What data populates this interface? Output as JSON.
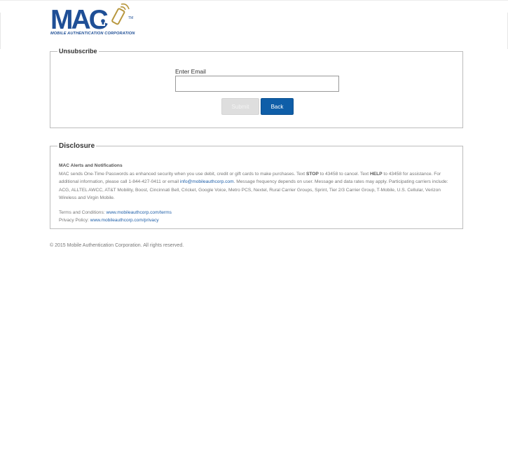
{
  "logo": {
    "title": "MAC",
    "tagline": "MOBILE AUTHENTICATION CORPORATION",
    "tm": "TM"
  },
  "unsubscribe": {
    "legend": "Unsubscribe",
    "email_label": "Enter Email",
    "email_value": "",
    "email_placeholder": "",
    "submit_label": "Submit",
    "back_label": "Back"
  },
  "disclosure": {
    "legend": "Disclosure",
    "title": "MAC Alerts and Notifications",
    "p1_a": "MAC sends One-Time Passwords as enhanced security when you use debit, credit or gift cards to make purchases. Text ",
    "stop": "STOP",
    "p1_b": " to 43458 to cancel. Text ",
    "help": "HELP",
    "p1_c": " to 43458 for assistance. For additional information, please call 1-844-427-0411 or email ",
    "email_link": "info@mobileauthcorp.com",
    "p1_d": ". Message frequency depends on user. Message and data rates may apply. Participating carriers include: ACG, ALLTEL AWCC, AT&T Mobility, Boost, Cincinnati Bell, Cricket, Google Voice, Metro PCS, Nextel, Rural Carrier Groups, Sprint, Tier 2/3 Carrier Group, T-Mobile, U.S. Cellular, Verizon Wireless and Virgin Mobile.",
    "terms_label": "Terms and Conditions: ",
    "terms_link": "www.mobileauthcorp.com/terms",
    "privacy_label": "Privacy Policy: ",
    "privacy_link": "www.mobileauthcorp.com/privacy"
  },
  "footer": {
    "copyright": "© 2015 Mobile Authentication Corporation. All rights reserved."
  },
  "colors": {
    "brand_blue": "#1f4f96",
    "brand_gold": "#b8973e",
    "button_blue": "#0f5ea8",
    "link_blue": "#1f5fa8"
  }
}
